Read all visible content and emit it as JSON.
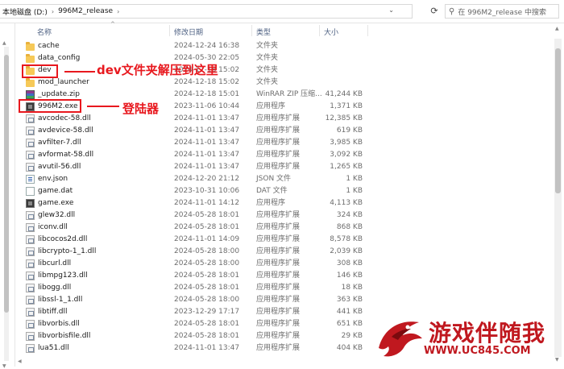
{
  "address": {
    "crumbs": [
      "本地磁盘 (D:)",
      "996M2_release"
    ],
    "search_placeholder": "在 996M2_release 中搜索"
  },
  "columns": {
    "name": "名称",
    "date": "修改日期",
    "type": "类型",
    "size": "大小"
  },
  "files": [
    {
      "name": "cache",
      "date": "2024-12-24 16:38",
      "type": "文件夹",
      "size": "",
      "icon": "folder"
    },
    {
      "name": "data_config",
      "date": "2024-05-30 22:05",
      "type": "文件夹",
      "size": "",
      "icon": "folder"
    },
    {
      "name": "dev",
      "date": "2024-12-18 15:02",
      "type": "文件夹",
      "size": "",
      "icon": "folder"
    },
    {
      "name": "mod_launcher",
      "date": "2024-12-18 15:02",
      "type": "文件夹",
      "size": "",
      "icon": "folder"
    },
    {
      "name": "_update.zip",
      "date": "2024-12-18 15:01",
      "type": "WinRAR ZIP 压缩...",
      "size": "41,244 KB",
      "icon": "zip"
    },
    {
      "name": "996M2.exe",
      "date": "2023-11-06 10:44",
      "type": "应用程序",
      "size": "1,371 KB",
      "icon": "app"
    },
    {
      "name": "avcodec-58.dll",
      "date": "2024-11-01 13:47",
      "type": "应用程序扩展",
      "size": "12,385 KB",
      "icon": "dll"
    },
    {
      "name": "avdevice-58.dll",
      "date": "2024-11-01 13:47",
      "type": "应用程序扩展",
      "size": "619 KB",
      "icon": "dll"
    },
    {
      "name": "avfilter-7.dll",
      "date": "2024-11-01 13:47",
      "type": "应用程序扩展",
      "size": "3,985 KB",
      "icon": "dll"
    },
    {
      "name": "avformat-58.dll",
      "date": "2024-11-01 13:47",
      "type": "应用程序扩展",
      "size": "3,092 KB",
      "icon": "dll"
    },
    {
      "name": "avutil-56.dll",
      "date": "2024-11-01 13:47",
      "type": "应用程序扩展",
      "size": "1,265 KB",
      "icon": "dll"
    },
    {
      "name": "env.json",
      "date": "2024-12-20 21:12",
      "type": "JSON 文件",
      "size": "1 KB",
      "icon": "json"
    },
    {
      "name": "game.dat",
      "date": "2023-10-31 10:06",
      "type": "DAT 文件",
      "size": "1 KB",
      "icon": "dat"
    },
    {
      "name": "game.exe",
      "date": "2024-11-01 14:12",
      "type": "应用程序",
      "size": "4,113 KB",
      "icon": "app"
    },
    {
      "name": "glew32.dll",
      "date": "2024-05-28 18:01",
      "type": "应用程序扩展",
      "size": "324 KB",
      "icon": "dll"
    },
    {
      "name": "iconv.dll",
      "date": "2024-05-28 18:01",
      "type": "应用程序扩展",
      "size": "868 KB",
      "icon": "dll"
    },
    {
      "name": "libcocos2d.dll",
      "date": "2024-11-01 14:09",
      "type": "应用程序扩展",
      "size": "8,578 KB",
      "icon": "dll"
    },
    {
      "name": "libcrypto-1_1.dll",
      "date": "2024-05-28 18:00",
      "type": "应用程序扩展",
      "size": "2,039 KB",
      "icon": "dll"
    },
    {
      "name": "libcurl.dll",
      "date": "2024-05-28 18:00",
      "type": "应用程序扩展",
      "size": "308 KB",
      "icon": "dll"
    },
    {
      "name": "libmpg123.dll",
      "date": "2024-05-28 18:01",
      "type": "应用程序扩展",
      "size": "146 KB",
      "icon": "dll"
    },
    {
      "name": "libogg.dll",
      "date": "2024-05-28 18:01",
      "type": "应用程序扩展",
      "size": "18 KB",
      "icon": "dll"
    },
    {
      "name": "libssl-1_1.dll",
      "date": "2024-05-28 18:00",
      "type": "应用程序扩展",
      "size": "363 KB",
      "icon": "dll"
    },
    {
      "name": "libtiff.dll",
      "date": "2023-12-29 17:17",
      "type": "应用程序扩展",
      "size": "441 KB",
      "icon": "dll"
    },
    {
      "name": "libvorbis.dll",
      "date": "2024-05-28 18:01",
      "type": "应用程序扩展",
      "size": "651 KB",
      "icon": "dll"
    },
    {
      "name": "libvorbisfile.dll",
      "date": "2024-05-28 18:01",
      "type": "应用程序扩展",
      "size": "29 KB",
      "icon": "dll"
    },
    {
      "name": "lua51.dll",
      "date": "2024-11-01 13:47",
      "type": "应用程序扩展",
      "size": "404 KB",
      "icon": "dll"
    }
  ],
  "annotations": {
    "dev_note": "dev文件夹解压到这里",
    "launcher_note": "登陆器",
    "color": "#e8181e"
  },
  "watermark": {
    "text": "游戏伴随我",
    "url": "WWW.UC845.COM",
    "color": "#c0181f"
  }
}
